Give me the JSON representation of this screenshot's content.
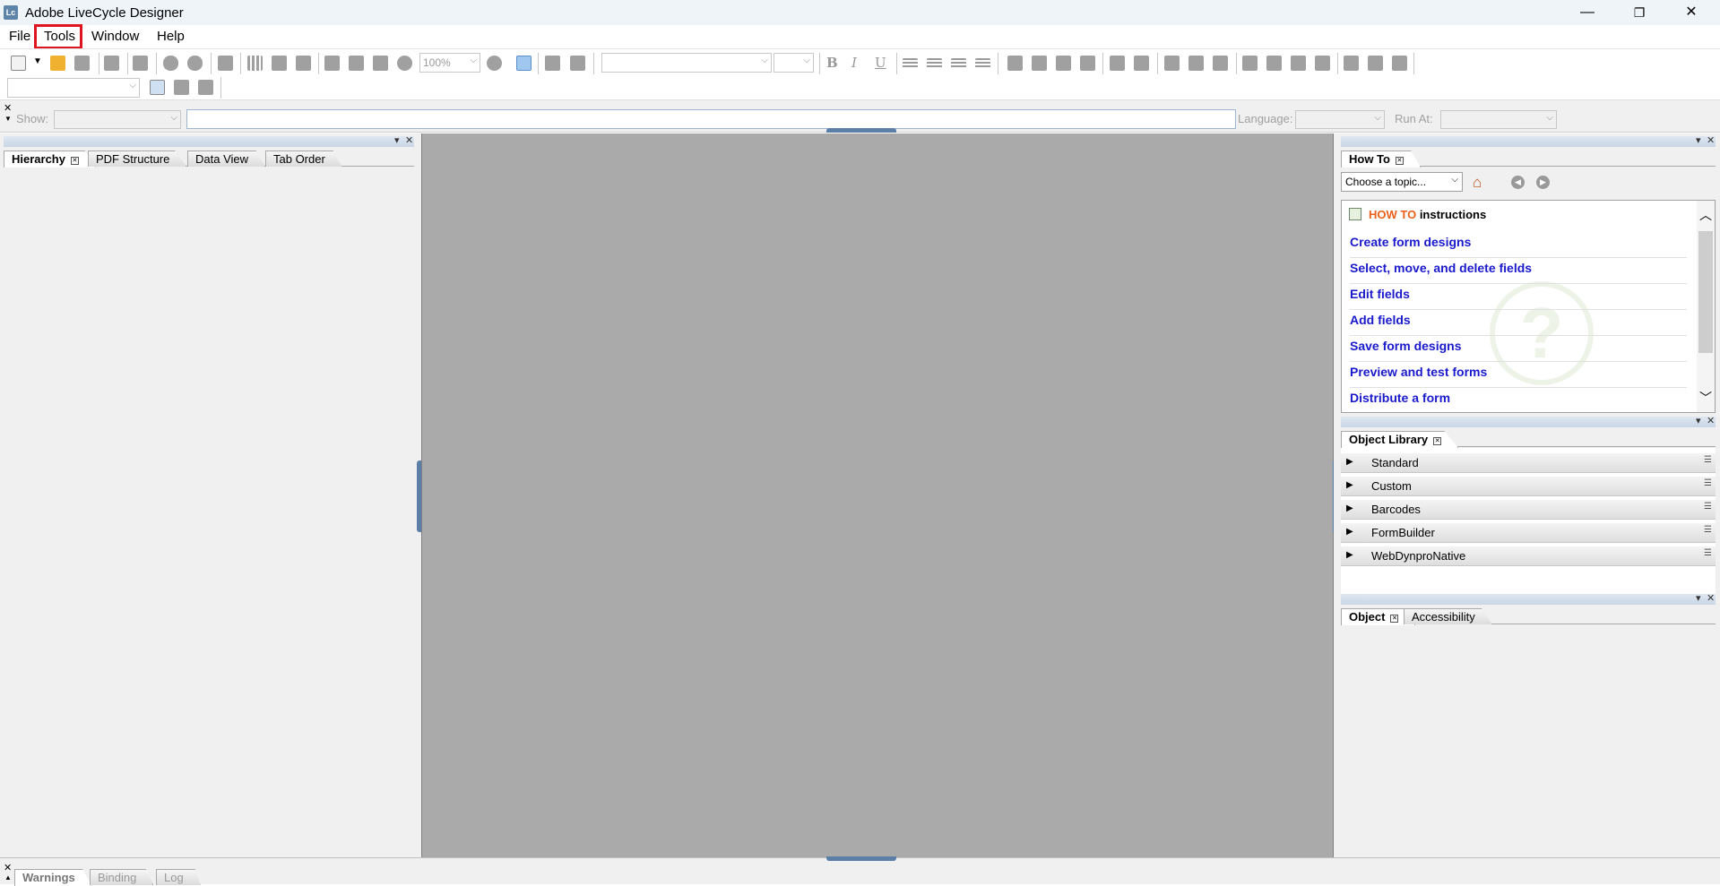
{
  "window": {
    "title": "Adobe LiveCycle Designer",
    "app_icon_text": "Lc",
    "minimize": "—",
    "restore": "❐",
    "close": "✕"
  },
  "menu": {
    "items": [
      "File",
      "Tools",
      "Window",
      "Help"
    ],
    "highlighted": "Tools",
    "highlight_color": "#e0141e"
  },
  "toolbar": {
    "zoom_value": "100%",
    "bold": "B",
    "italic": "I",
    "underline": "U"
  },
  "script_bar": {
    "show_label": "Show:",
    "language_label": "Language:",
    "run_at_label": "Run At:"
  },
  "left_panel": {
    "tabs": [
      "Hierarchy",
      "PDF Structure",
      "Data View",
      "Tab Order"
    ],
    "active_tab": "Hierarchy"
  },
  "howto": {
    "tab": "How To",
    "topic_placeholder": "Choose a topic...",
    "heading_highlight": "HOW TO",
    "heading_rest": " instructions",
    "links": [
      "Create form designs",
      "Select, move, and delete fields",
      "Edit fields",
      "Add fields",
      "Save form designs",
      "Preview and test forms",
      "Distribute a form"
    ]
  },
  "object_library": {
    "tab": "Object Library",
    "groups": [
      "Standard",
      "Custom",
      "Barcodes",
      "FormBuilder",
      "WebDynproNative"
    ]
  },
  "object_panel": {
    "tabs": [
      "Object",
      "Accessibility"
    ]
  },
  "bottom_panel": {
    "tabs": [
      "Warnings",
      "Binding",
      "Log"
    ]
  },
  "colors": {
    "canvas": "#aaaaaa",
    "link": "#1a1acc",
    "howto_orange": "#e8601c"
  }
}
